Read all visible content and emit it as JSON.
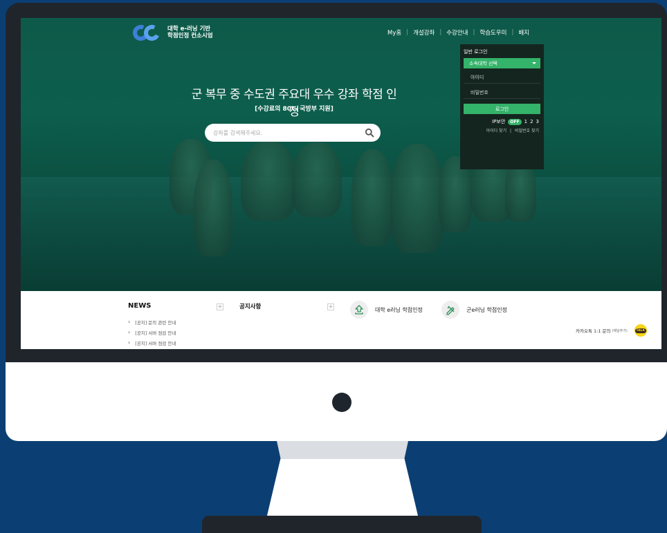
{
  "logo": {
    "line1": "대학 e-러닝 기반",
    "line2": "학점인정 컨소시엄"
  },
  "nav": {
    "items": [
      {
        "label": "My홈"
      },
      {
        "label": "개설강좌"
      },
      {
        "label": "수강안내"
      },
      {
        "label": "학습도우미"
      },
      {
        "label": "배지"
      }
    ]
  },
  "hero": {
    "title": "군 복무 중 수도권 주요대 우수 강좌 학점 인정",
    "subtitle": "[수강료의 80% 국방부 지원]",
    "search_placeholder": "강좌를 검색해주세요."
  },
  "login": {
    "title": "일반 로그인",
    "school_select": "소속대학 선택",
    "id_placeholder": "아이디",
    "password_placeholder": "비밀번호",
    "button": "로그인",
    "ip_security_label": "IP보안",
    "ip_security_state": "OFF",
    "ip_levels": [
      "1",
      "2",
      "3"
    ],
    "find_id": "아이디 찾기",
    "find_password": "비밀번호 찾기"
  },
  "news": {
    "title": "NEWS",
    "items": [
      {
        "text": "[공지] 문의 관련 안내"
      },
      {
        "text": "[공지] 서버 점검 안내"
      },
      {
        "text": "[공지] 서버 점검 안내"
      }
    ]
  },
  "notice": {
    "title": "공지사항"
  },
  "more_label": "+",
  "certifications": [
    {
      "label": "대학 e러닝 학점인정",
      "icon": "graduation-upload-icon"
    },
    {
      "label": "군e러닝 학점인정",
      "icon": "pencil-ruler-icon"
    }
  ],
  "kakao": {
    "label": "카카오톡 1:1 문의",
    "note": "(채널추가)",
    "badge": "TALK"
  },
  "colors": {
    "accent_green": "#34b36a",
    "hero_green": "#0d5e4d",
    "monitor_frame": "#20252c",
    "background_blue": "#0b3f73",
    "logo_blue": "#3d7fd8",
    "kakao_yellow": "#f7d417"
  }
}
